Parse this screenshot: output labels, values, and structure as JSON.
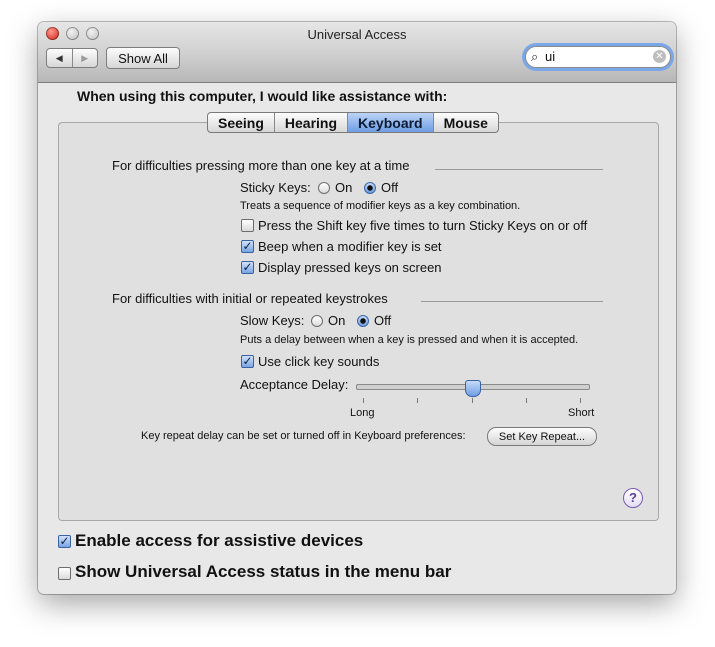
{
  "window": {
    "title": "Universal Access"
  },
  "toolbar": {
    "back_glyph": "◀",
    "forward_glyph": "▶",
    "show_all_label": "Show All",
    "search": {
      "value": "ui",
      "icon": "search-icon",
      "clear_icon": "clear-icon",
      "clear_glyph": "✕"
    }
  },
  "heading": "When using this computer, I would like assistance with:",
  "tabs": [
    {
      "label": "Seeing",
      "active": false
    },
    {
      "label": "Hearing",
      "active": false
    },
    {
      "label": "Keyboard",
      "active": true
    },
    {
      "label": "Mouse",
      "active": false
    }
  ],
  "sticky": {
    "section_title": "For difficulties pressing more than one key at a time",
    "label": "Sticky Keys:",
    "on_label": "On",
    "off_label": "Off",
    "selected": "Off",
    "description": "Treats a sequence of modifier keys as a key combination.",
    "options": [
      {
        "label": "Press the Shift key five times to turn Sticky Keys on or off",
        "checked": false
      },
      {
        "label": "Beep when a modifier key is set",
        "checked": true
      },
      {
        "label": "Display pressed keys on screen",
        "checked": true
      }
    ]
  },
  "slow": {
    "section_title": "For difficulties with initial or repeated keystrokes",
    "label": "Slow Keys:",
    "on_label": "On",
    "off_label": "Off",
    "selected": "Off",
    "description": "Puts a delay between when a key is pressed and when it is accepted.",
    "click_sounds_label": "Use click key sounds",
    "click_sounds_checked": true,
    "acceptance_delay_label": "Acceptance Delay:",
    "slider_min_label": "Long",
    "slider_max_label": "Short",
    "slider_value_fraction": 0.5
  },
  "key_repeat": {
    "note": "Key repeat delay can be set or turned off in Keyboard preferences:",
    "button_label": "Set Key Repeat..."
  },
  "help_glyph": "?",
  "bottom": {
    "assistive_label": "Enable access for assistive devices",
    "assistive_checked": true,
    "status_label": "Show Universal Access status in the menu bar",
    "status_checked": false
  },
  "check_glyph": "✓",
  "colors": {
    "accent": "#6f9ee4",
    "close": "#e0443a"
  }
}
